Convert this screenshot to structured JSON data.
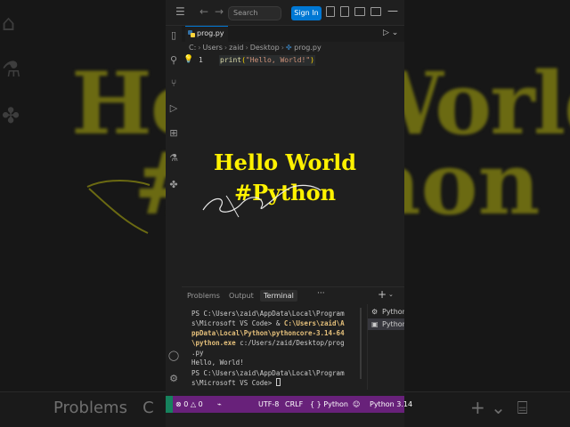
{
  "background": {
    "big_line1": "Hello World",
    "big_line2": "#Python",
    "problems": "Problems",
    "partial": "C"
  },
  "titlebar": {
    "search_placeholder": "Search",
    "signin_label": "Sign In"
  },
  "editor": {
    "tab_label": "prog.py",
    "breadcrumb": [
      "C:",
      "Users",
      "zaid",
      "Desktop",
      "prog.py"
    ],
    "line_number": "1",
    "code": {
      "fn": "print",
      "open": "(",
      "str": "\"Hello, World!\"",
      "close": ")"
    }
  },
  "overlay": {
    "line1": "Hello World",
    "line2": "#Python",
    "color": "#fff200"
  },
  "panel": {
    "tabs": [
      "Problems",
      "Output",
      "Terminal"
    ],
    "active_tab": "Terminal",
    "more": "···"
  },
  "terminal": {
    "l1": "PS C:\\Users\\zaid\\AppData\\Local\\Program",
    "l2a": "s\\Microsoft VS Code> & ",
    "l2b": "C:\\Users\\zaid\\A",
    "l3": "ppData\\Local\\Python\\pythoncore-3.14-64",
    "l4a": "\\python.exe",
    "l4b": " c:/Users/zaid/Desktop/prog",
    "l5": ".py",
    "l6": "Hello, World!",
    "l7": "PS C:\\Users\\zaid\\AppData\\Local\\Program",
    "l8": "s\\Microsoft VS Code> "
  },
  "terminal_list": [
    "Python",
    "Python"
  ],
  "statusbar": {
    "errors": "0",
    "warnings": "0",
    "encoding": "UTF-8",
    "eol": "CRLF",
    "language": "Python",
    "interpreter": "Python 3.14",
    "color": "#68217a"
  }
}
